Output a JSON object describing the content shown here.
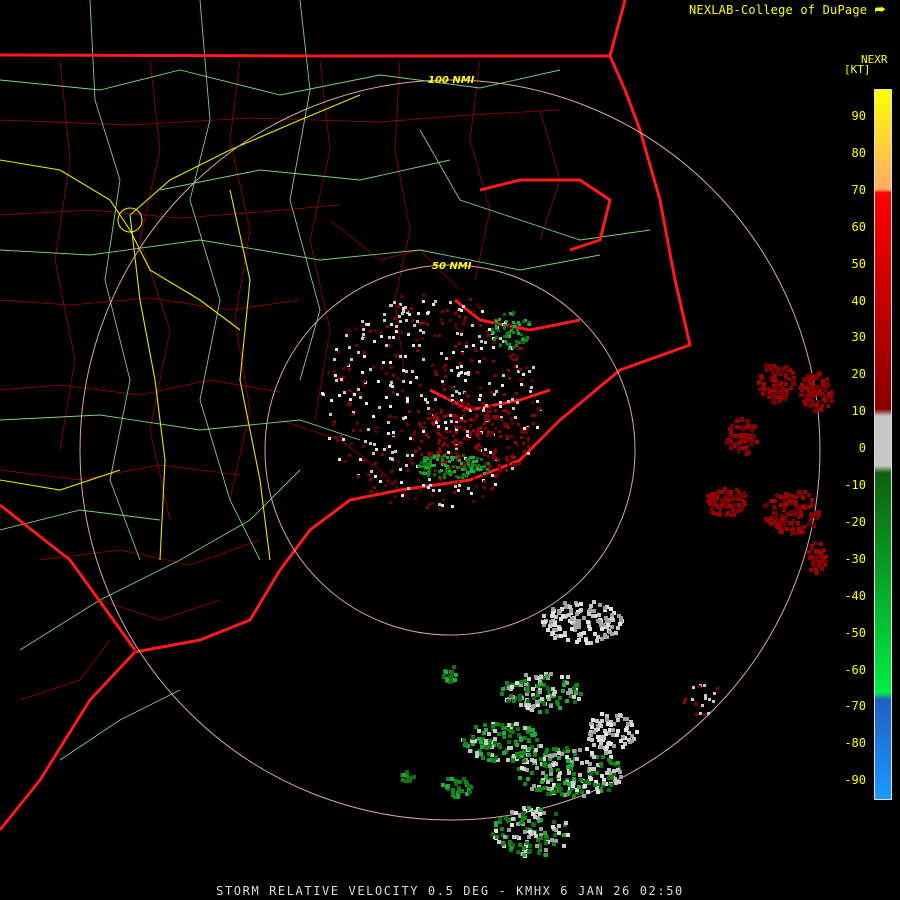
{
  "header": {
    "credit": "NEXLAB-College of DuPage",
    "logo_icon": "cod-logo-icon"
  },
  "legend": {
    "product_code": "NEXR",
    "unit": "[KT]",
    "ticks": [
      "90",
      "80",
      "70",
      "60",
      "50",
      "40",
      "30",
      "20",
      "10",
      "0",
      "-10",
      "-20",
      "-30",
      "-40",
      "-50",
      "-60",
      "-70",
      "-80",
      "-90"
    ],
    "colors": {
      "yellow": "#ffff00",
      "orange": "#ffb060",
      "red_bright": "#ff0000",
      "red_dark": "#8b0000",
      "gray": "#c8c8c8",
      "green_dark": "#0f5f0f",
      "green_bright": "#00ee44",
      "blue": "#2060c0",
      "cyan_blue": "#1a9bff"
    }
  },
  "range_rings": {
    "inner_label": "50 NMI",
    "outer_label": "100 NMI"
  },
  "footer": {
    "caption": "STORM RELATIVE VELOCITY 0.5 DEG - KMHX 6 JAN 26 02:50"
  },
  "map_colors": {
    "state_border": "#ff1a1a",
    "county_lines": "#b00000",
    "roads_major": "#e8e800",
    "roads_minor": "#88d888",
    "ring": "#d8a8a0"
  }
}
